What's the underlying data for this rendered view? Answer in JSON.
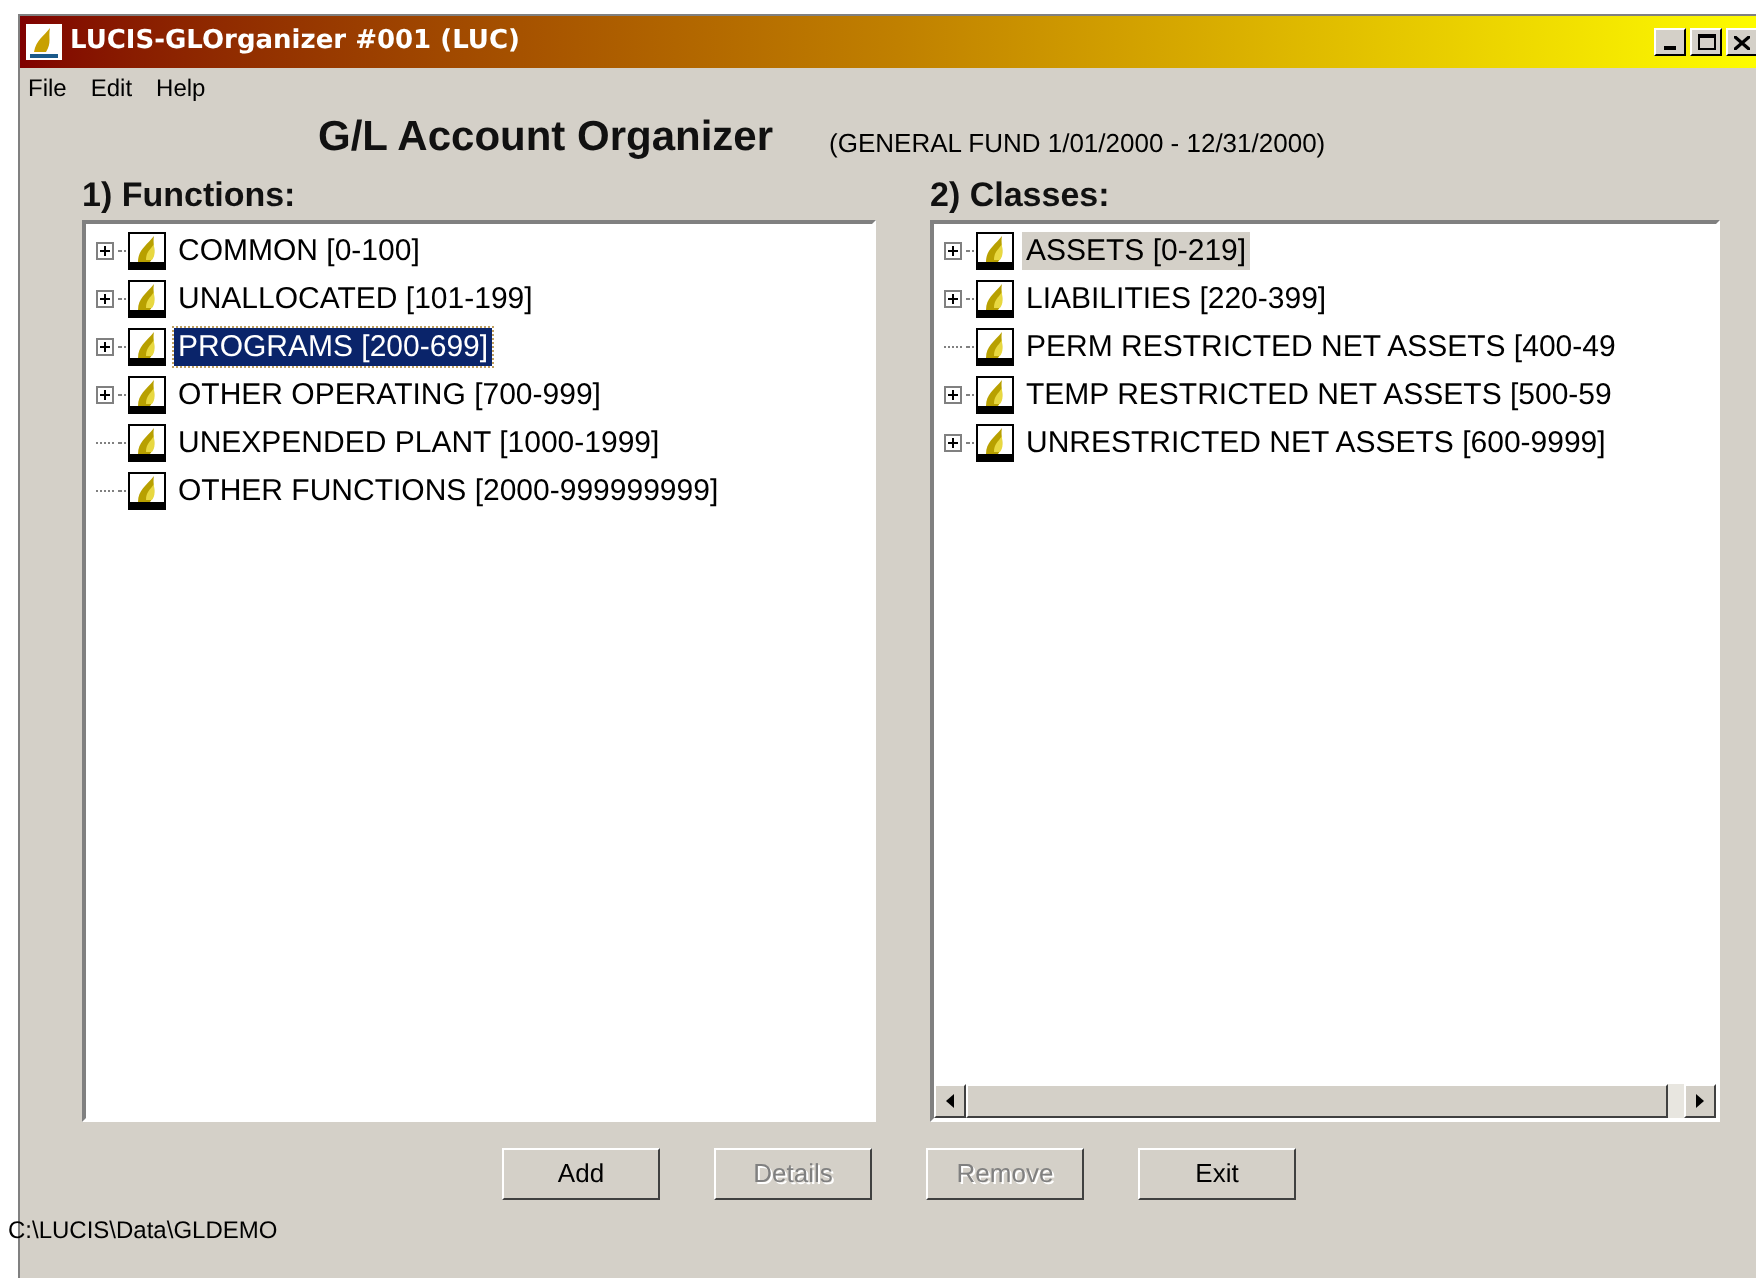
{
  "window": {
    "title": "LUCIS-GLOrganizer #001 (LUC)"
  },
  "menu": [
    "File",
    "Edit",
    "Help"
  ],
  "heading": "G/L Account Organizer",
  "fund_info": "(GENERAL FUND  1/01/2000 - 12/31/2000)",
  "functions": {
    "label": "1) Functions:",
    "items": [
      {
        "text": "COMMON [0-100]",
        "expandable": true,
        "selected": false
      },
      {
        "text": "UNALLOCATED [101-199]",
        "expandable": true,
        "selected": false
      },
      {
        "text": "PROGRAMS [200-699]",
        "expandable": true,
        "selected": true
      },
      {
        "text": "OTHER OPERATING [700-999]",
        "expandable": true,
        "selected": false
      },
      {
        "text": "UNEXPENDED PLANT [1000-1999]",
        "expandable": false,
        "selected": false
      },
      {
        "text": "OTHER FUNCTIONS [2000-999999999]",
        "expandable": false,
        "selected": false
      }
    ]
  },
  "classes": {
    "label": "2) Classes:",
    "items": [
      {
        "text": "ASSETS [0-219]",
        "expandable": true,
        "selected": true
      },
      {
        "text": "LIABILITIES [220-399]",
        "expandable": true,
        "selected": false
      },
      {
        "text": "PERM RESTRICTED NET ASSETS [400-49",
        "expandable": false,
        "selected": false
      },
      {
        "text": "TEMP RESTRICTED NET ASSETS [500-59",
        "expandable": true,
        "selected": false
      },
      {
        "text": "UNRESTRICTED NET ASSETS [600-9999]",
        "expandable": true,
        "selected": false
      }
    ]
  },
  "buttons": [
    {
      "label": "Add",
      "disabled": false
    },
    {
      "label": "Details",
      "disabled": true
    },
    {
      "label": "Remove",
      "disabled": true
    },
    {
      "label": "Exit",
      "disabled": false
    }
  ],
  "status_bar": "C:\\LUCIS\\Data\\GLDEMO"
}
